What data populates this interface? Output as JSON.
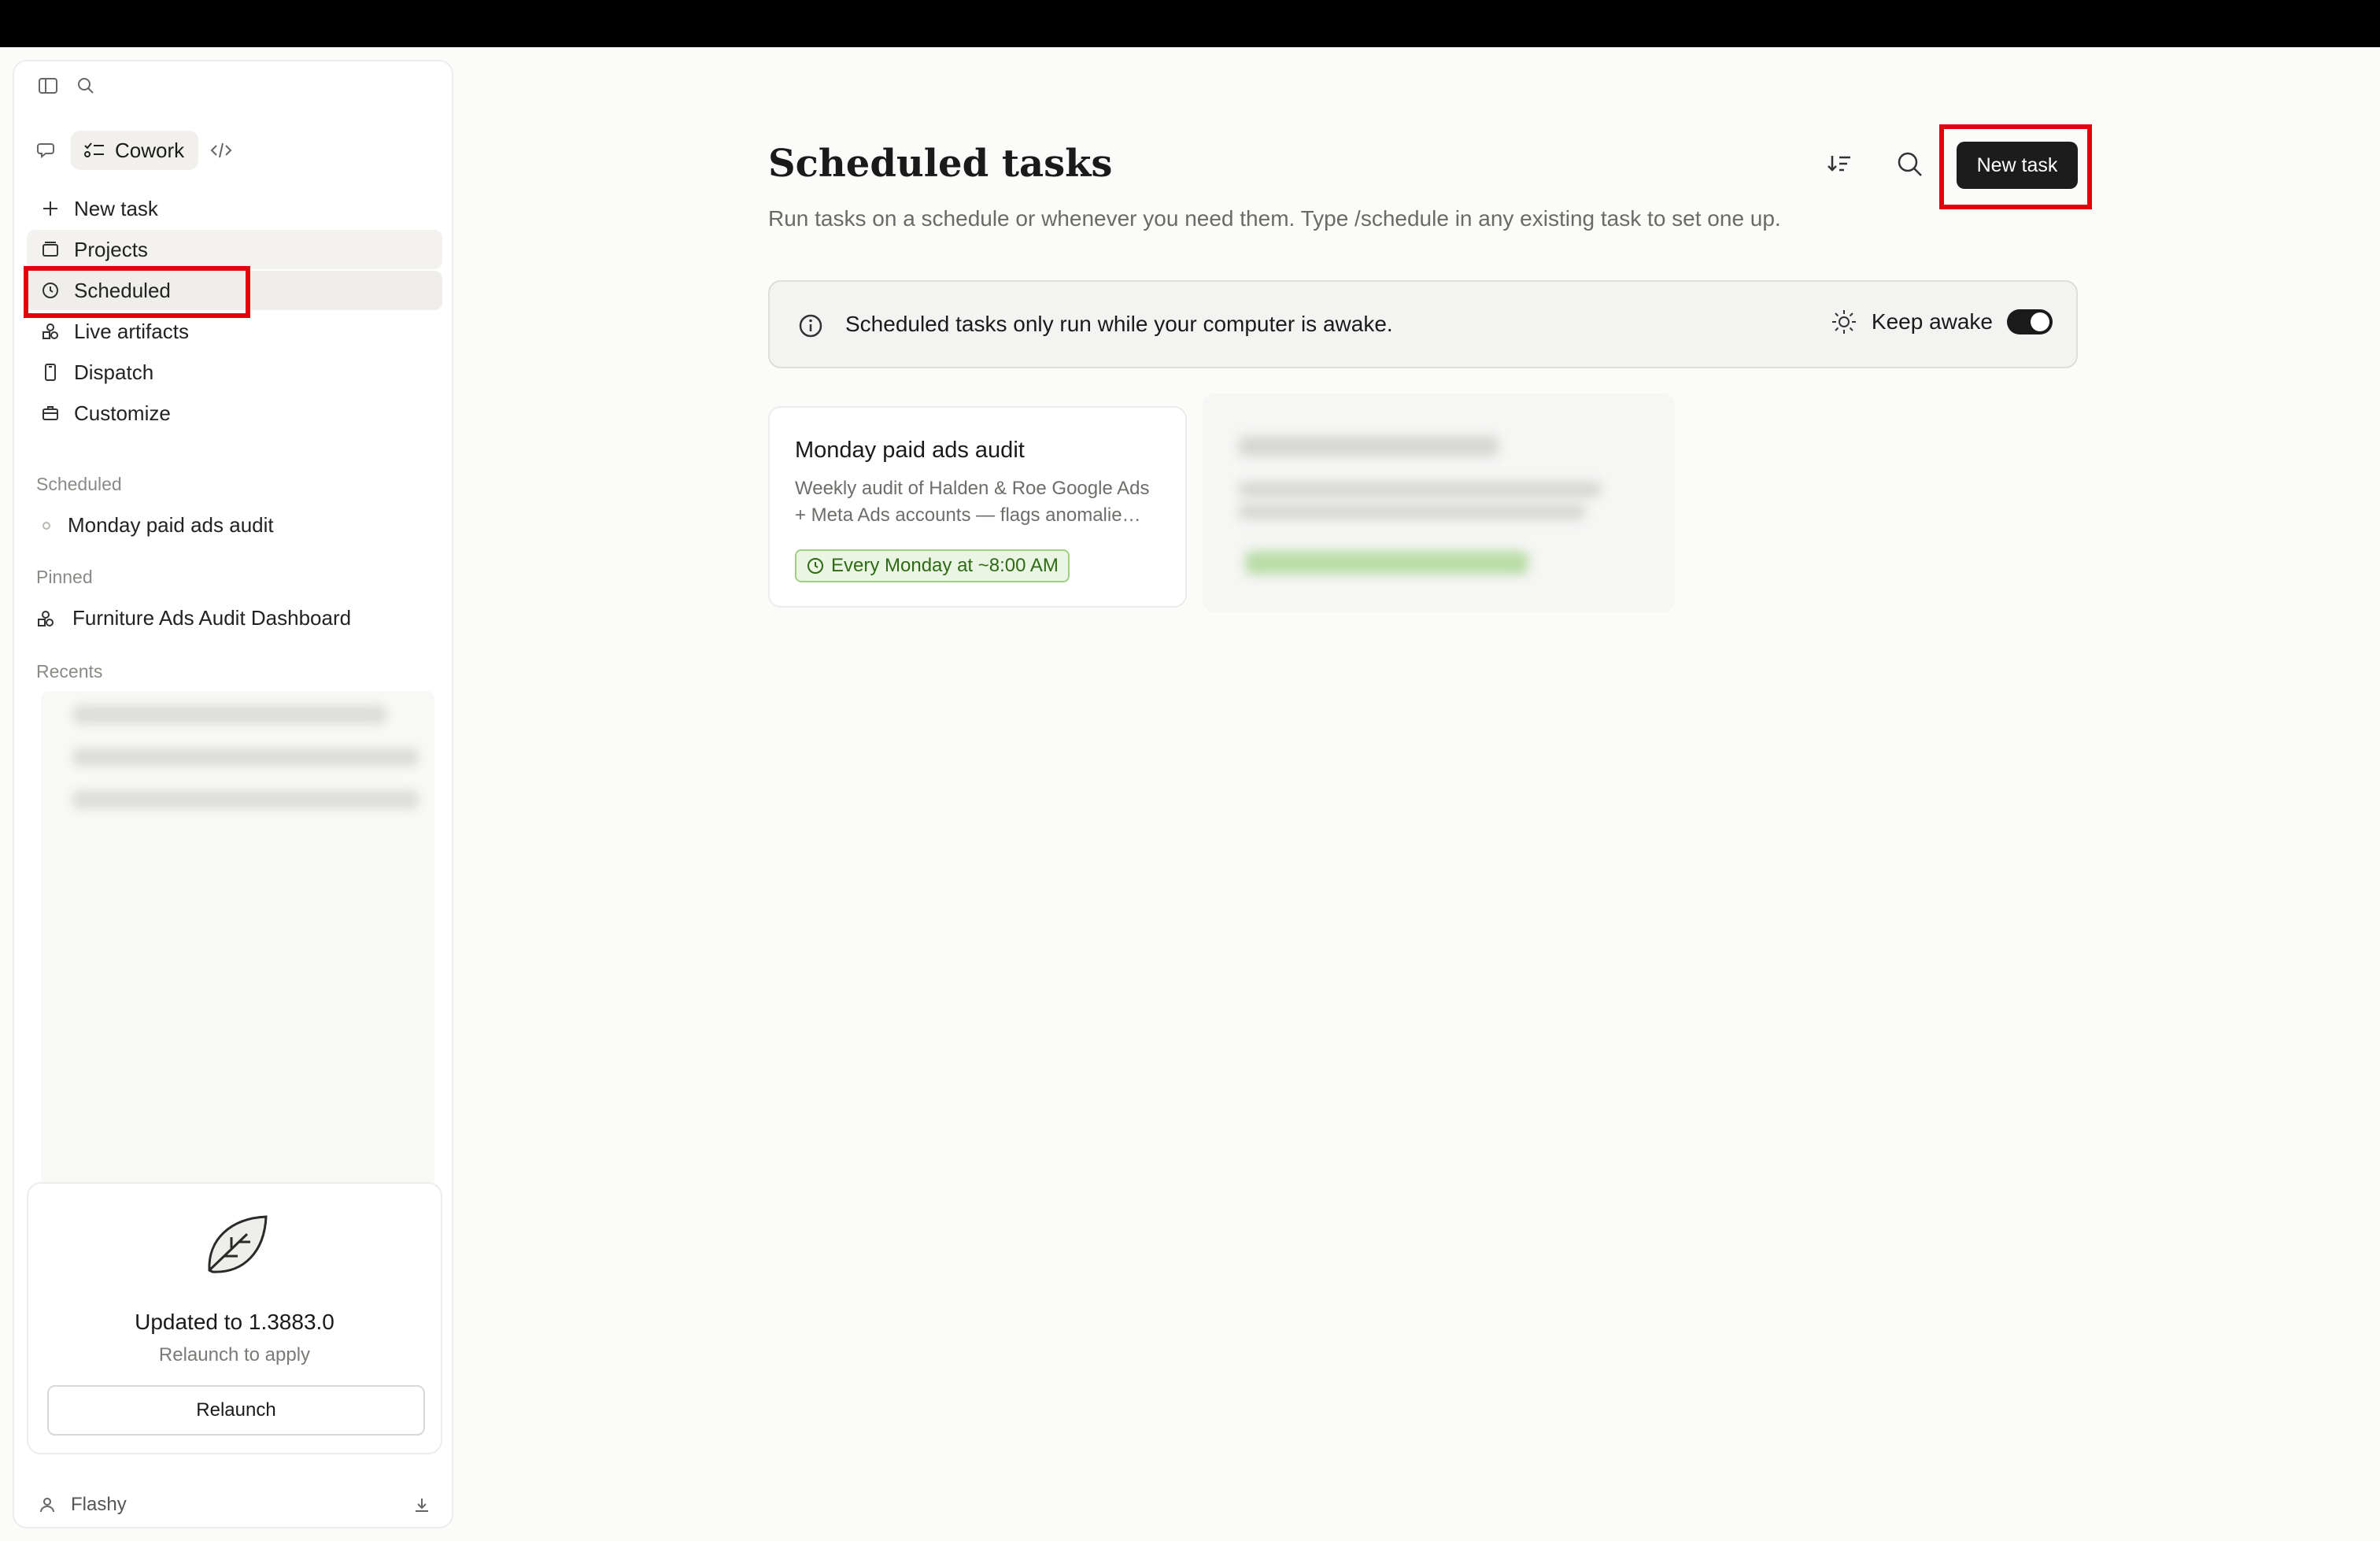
{
  "mode": {
    "label": "Cowork"
  },
  "nav": [
    {
      "label": "New task"
    },
    {
      "label": "Projects"
    },
    {
      "label": "Scheduled"
    },
    {
      "label": "Live artifacts"
    },
    {
      "label": "Dispatch"
    },
    {
      "label": "Customize"
    }
  ],
  "sections": {
    "scheduled_label": "Scheduled",
    "scheduled_items": [
      "Monday paid ads audit"
    ],
    "pinned_label": "Pinned",
    "pinned_items": [
      "Furniture Ads Audit Dashboard"
    ],
    "recents_label": "Recents"
  },
  "update": {
    "title": "Updated to 1.3883.0",
    "subtitle": "Relaunch to apply",
    "button": "Relaunch"
  },
  "user": {
    "name": "Flashy"
  },
  "page": {
    "title": "Scheduled tasks",
    "subtitle": "Run tasks on a schedule or whenever you need them. Type /schedule in any existing task to set one up.",
    "new_task_button": "New task"
  },
  "notice": {
    "text": "Scheduled tasks only run while your computer is awake.",
    "keep_awake_label": "Keep awake",
    "keep_awake_on": true
  },
  "tasks": [
    {
      "title": "Monday paid ads audit",
      "description": "Weekly audit of Halden & Roe Google Ads + Meta Ads accounts — flags anomalie…",
      "schedule": "Every Monday at ~8:00 AM"
    }
  ],
  "colors": {
    "highlight": "#e3000f",
    "badge_green": "#2e6b14",
    "primary_button": "#1c1c1c"
  }
}
